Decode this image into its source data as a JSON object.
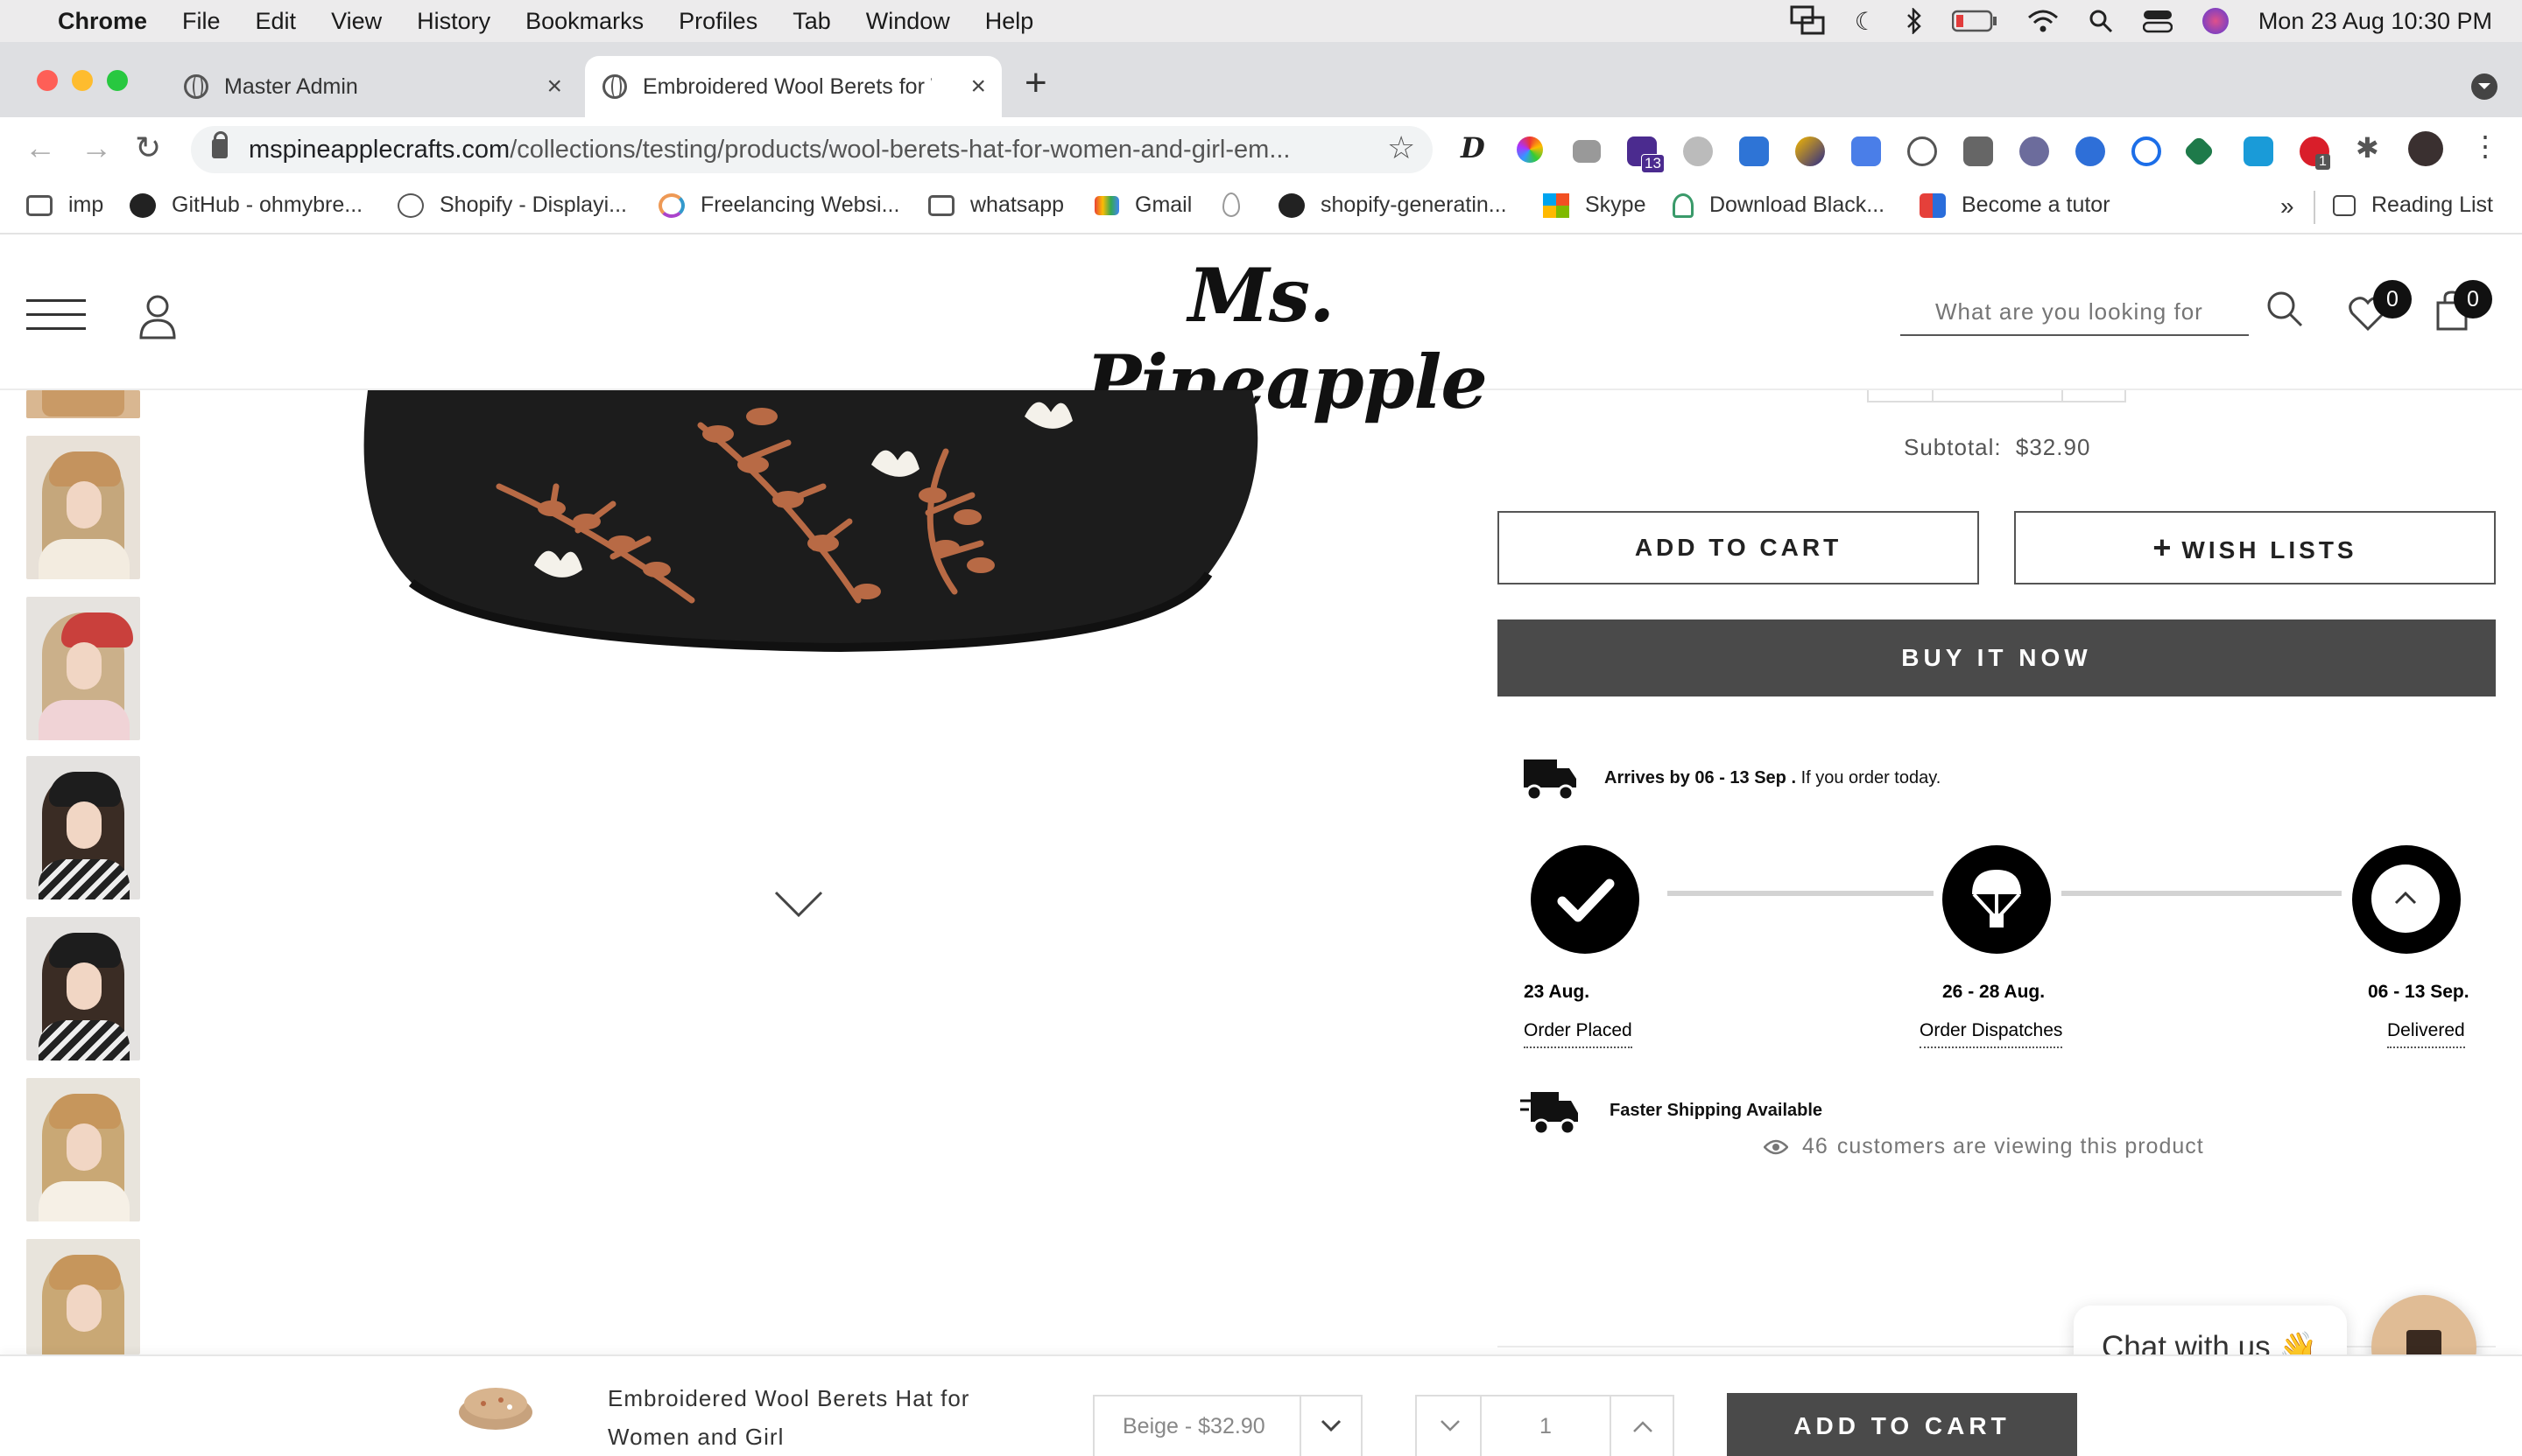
{
  "menubar": {
    "app": "Chrome",
    "items": [
      "File",
      "Edit",
      "View",
      "History",
      "Bookmarks",
      "Profiles",
      "Tab",
      "Window",
      "Help"
    ],
    "datetime": "Mon 23 Aug  10:30 PM"
  },
  "tabs": [
    {
      "title": "Master Admin"
    },
    {
      "title": "Embroidered Wool Berets for W"
    }
  ],
  "address": {
    "host": "mspineapplecrafts.com",
    "path": "/collections/testing/products/wool-berets-hat-for-women-and-girl-em..."
  },
  "extensions": {
    "badge_count": "13",
    "abp_badge": "1"
  },
  "bookmarks": [
    {
      "label": "imp",
      "icon": "folder-icon"
    },
    {
      "label": "GitHub - ohmybre...",
      "icon": "github-icon"
    },
    {
      "label": "Shopify - Displayi...",
      "icon": "shopify-icon"
    },
    {
      "label": "Freelancing Websi...",
      "icon": "ring-icon"
    },
    {
      "label": "whatsapp",
      "icon": "folder-icon"
    },
    {
      "label": "Gmail",
      "icon": "gmail-icon"
    },
    {
      "label": "",
      "icon": "drop-icon"
    },
    {
      "label": "shopify-generatin...",
      "icon": "github-icon"
    },
    {
      "label": "Skype",
      "icon": "windows-icon"
    },
    {
      "label": "Download Black...",
      "icon": "plant-icon"
    },
    {
      "label": "Become a tutor",
      "icon": "tutor-icon"
    }
  ],
  "bookmarks_more": "»",
  "reading_list": "Reading List",
  "site": {
    "logo": "Ms. Pineapple",
    "search_placeholder": "What are you looking for",
    "wishlist_count": "0",
    "cart_count": "0"
  },
  "product": {
    "subtotal_label": "Subtotal:",
    "subtotal_value": "$32.90",
    "add_to_cart": "ADD TO CART",
    "wish_lists": "WISH LISTS",
    "buy_now": "BUY IT NOW",
    "arrives_bold": "Arrives by 06 - 13 Sep .",
    "arrives_rest": " If you order today.",
    "steps": [
      {
        "date": "23 Aug.",
        "label": "Order Placed"
      },
      {
        "date": "26 - 28 Aug.",
        "label": "Order Dispatches"
      },
      {
        "date": "06 - 13 Sep.",
        "label": "Delivered"
      }
    ],
    "faster_shipping": "Faster Shipping Available",
    "viewers_count": "46",
    "viewers_text": "customers are viewing this product"
  },
  "chat": {
    "label": "Chat with us",
    "emoji": "👋"
  },
  "sticky": {
    "title_line1": "Embroidered Wool Berets Hat for",
    "title_line2": "Women and Girl",
    "variant": "Beige - $32.90",
    "qty": "1",
    "add_to_cart": "ADD TO CART"
  },
  "colors": {
    "button_dark": "#4a4a4a",
    "chat_button": "#e0bc95",
    "embroidery": "#b86a45"
  }
}
